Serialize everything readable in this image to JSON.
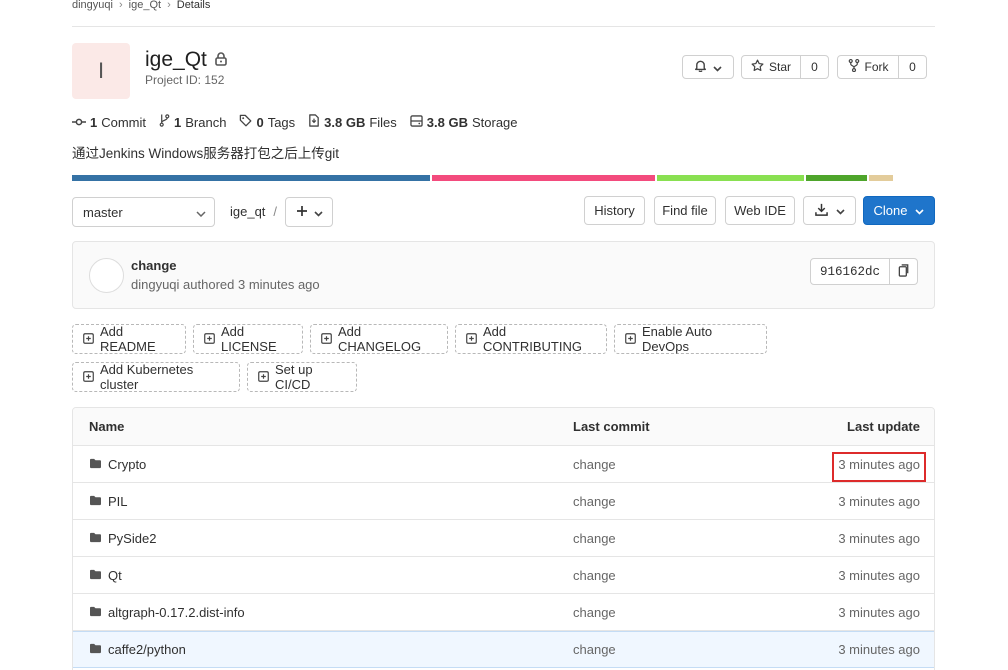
{
  "breadcrumb": [
    "dingyuqi",
    "ige_Qt",
    "Details"
  ],
  "project": {
    "avatar_letter": "I",
    "name": "ige_Qt",
    "id_label": "Project ID: 152",
    "description": "通过Jenkins Windows服务器打包之后上传git"
  },
  "actions": {
    "star_label": "Star",
    "star_count": "0",
    "fork_label": "Fork",
    "fork_count": "0"
  },
  "stats": [
    {
      "icon": "commit-icon",
      "value": "1",
      "label": "Commit"
    },
    {
      "icon": "branch-icon",
      "value": "1",
      "label": "Branch"
    },
    {
      "icon": "tag-icon",
      "value": "0",
      "label": "Tags"
    },
    {
      "icon": "files-icon",
      "value": "3.8 GB",
      "label": "Files"
    },
    {
      "icon": "storage-icon",
      "value": "3.8 GB",
      "label": "Storage"
    }
  ],
  "language_bar": [
    {
      "color": "#3572a5",
      "share": 0.427
    },
    {
      "color": "#f34b7d",
      "share": 0.266
    },
    {
      "color": "#89e051",
      "share": 0.175
    },
    {
      "color": "#4ea52b",
      "share": 0.073
    },
    {
      "color": "#e3cc9b",
      "share": 0.029
    }
  ],
  "toolbar": {
    "branch": "master",
    "path": "ige_qt",
    "path_sep": "/",
    "history": "History",
    "find_file": "Find file",
    "web_ide": "Web IDE",
    "clone": "Clone"
  },
  "commit": {
    "title": "change",
    "author": "dingyuqi",
    "meta_rest": " authored 3 minutes ago",
    "sha": "916162dc"
  },
  "quick_actions": [
    "Add README",
    "Add LICENSE",
    "Add CHANGELOG",
    "Add CONTRIBUTING",
    "Enable Auto DevOps",
    "Add Kubernetes cluster",
    "Set up CI/CD"
  ],
  "table": {
    "headers": {
      "name": "Name",
      "last_commit": "Last commit",
      "last_update": "Last update"
    },
    "rows": [
      {
        "name": "Crypto",
        "commit": "change",
        "updated": "3 minutes ago"
      },
      {
        "name": "PIL",
        "commit": "change",
        "updated": "3 minutes ago"
      },
      {
        "name": "PySide2",
        "commit": "change",
        "updated": "3 minutes ago"
      },
      {
        "name": "Qt",
        "commit": "change",
        "updated": "3 minutes ago"
      },
      {
        "name": "altgraph-0.17.2.dist-info",
        "commit": "change",
        "updated": "3 minutes ago"
      },
      {
        "name": "caffe2/python",
        "commit": "change",
        "updated": "3 minutes ago"
      }
    ]
  },
  "colors": {
    "primary": "#1f75cb",
    "highlight_border": "#dd2b2b"
  }
}
